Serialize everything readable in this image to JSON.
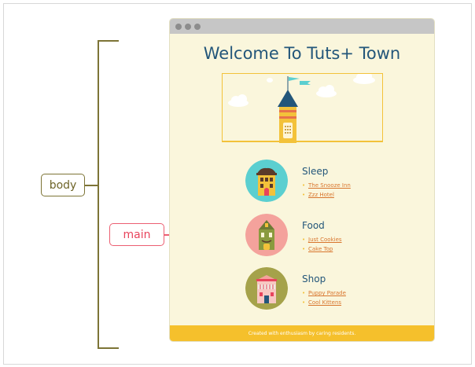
{
  "annotations": {
    "body_label": "body",
    "main_label": "main"
  },
  "page": {
    "heading": "Welcome To Tuts+ Town",
    "footer": "Created with enthusiasm by caring residents."
  },
  "sections": [
    {
      "title": "Sleep",
      "links": [
        "The Snooze Inn",
        "Zzz Hotel"
      ],
      "circle_color": "#5bcfd0",
      "icon": "hotel-building-icon"
    },
    {
      "title": "Food",
      "links": [
        "Just Cookies",
        "Cake Top"
      ],
      "circle_color": "#f4a29c",
      "icon": "bakery-building-icon"
    },
    {
      "title": "Shop",
      "links": [
        "Puppy Parade",
        "Cool Kittens"
      ],
      "circle_color": "#a5a24a",
      "icon": "shop-building-icon"
    }
  ],
  "colors": {
    "body_bracket": "#7d7436",
    "main_bracket": "#ec5f72",
    "page_bg": "#faf6dc",
    "heading": "#23567a",
    "accent_yellow": "#f5c02c",
    "link": "#d8752d"
  }
}
